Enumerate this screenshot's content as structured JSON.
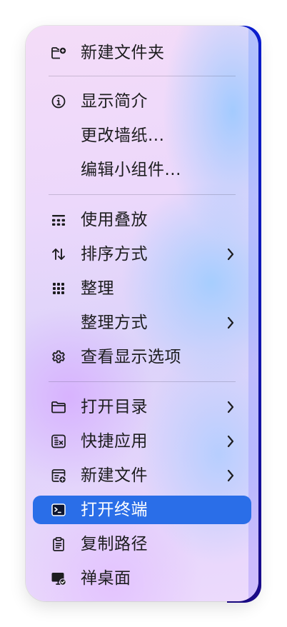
{
  "menu": {
    "items": [
      {
        "label": "新建文件夹",
        "icon": "new-folder-icon"
      },
      {
        "label": "显示简介",
        "icon": "info-icon"
      },
      {
        "label": "更改墙纸...",
        "icon": ""
      },
      {
        "label": "编辑小组件...",
        "icon": ""
      },
      {
        "label": "使用叠放",
        "icon": "stacks-icon"
      },
      {
        "label": "排序方式",
        "icon": "sort-arrows-icon",
        "submenu": true
      },
      {
        "label": "整理",
        "icon": "grid-icon"
      },
      {
        "label": "整理方式",
        "icon": "",
        "submenu": true
      },
      {
        "label": "查看显示选项",
        "icon": "gear-icon"
      },
      {
        "label": "打开目录",
        "icon": "folder-icon",
        "submenu": true
      },
      {
        "label": "快捷应用",
        "icon": "app-shortcut-icon",
        "submenu": true
      },
      {
        "label": "新建文件",
        "icon": "new-file-icon",
        "submenu": true
      },
      {
        "label": "打开终端",
        "icon": "terminal-icon",
        "selected": true
      },
      {
        "label": "复制路径",
        "icon": "clipboard-icon"
      },
      {
        "label": "禅桌面",
        "icon": "zen-desktop-icon"
      }
    ]
  },
  "colors": {
    "selection": "#2a6ee8",
    "text": "#1d1d1f"
  }
}
